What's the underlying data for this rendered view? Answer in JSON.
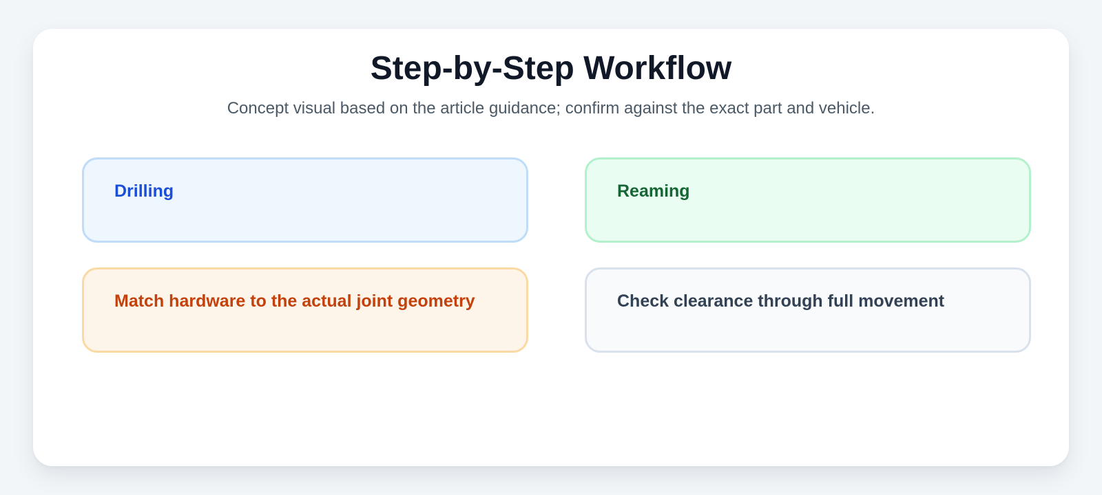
{
  "header": {
    "title": "Step-by-Step Workflow",
    "subtitle": "Concept visual based on the article guidance; confirm against the exact part and vehicle."
  },
  "steps": [
    {
      "label": "Drilling",
      "color": "#1d4ed8"
    },
    {
      "label": "Reaming",
      "color": "#166534"
    },
    {
      "label": "Match hardware to the actual joint geometry",
      "color": "#c2410c"
    },
    {
      "label": "Check clearance through full movement",
      "color": "#334155"
    }
  ]
}
